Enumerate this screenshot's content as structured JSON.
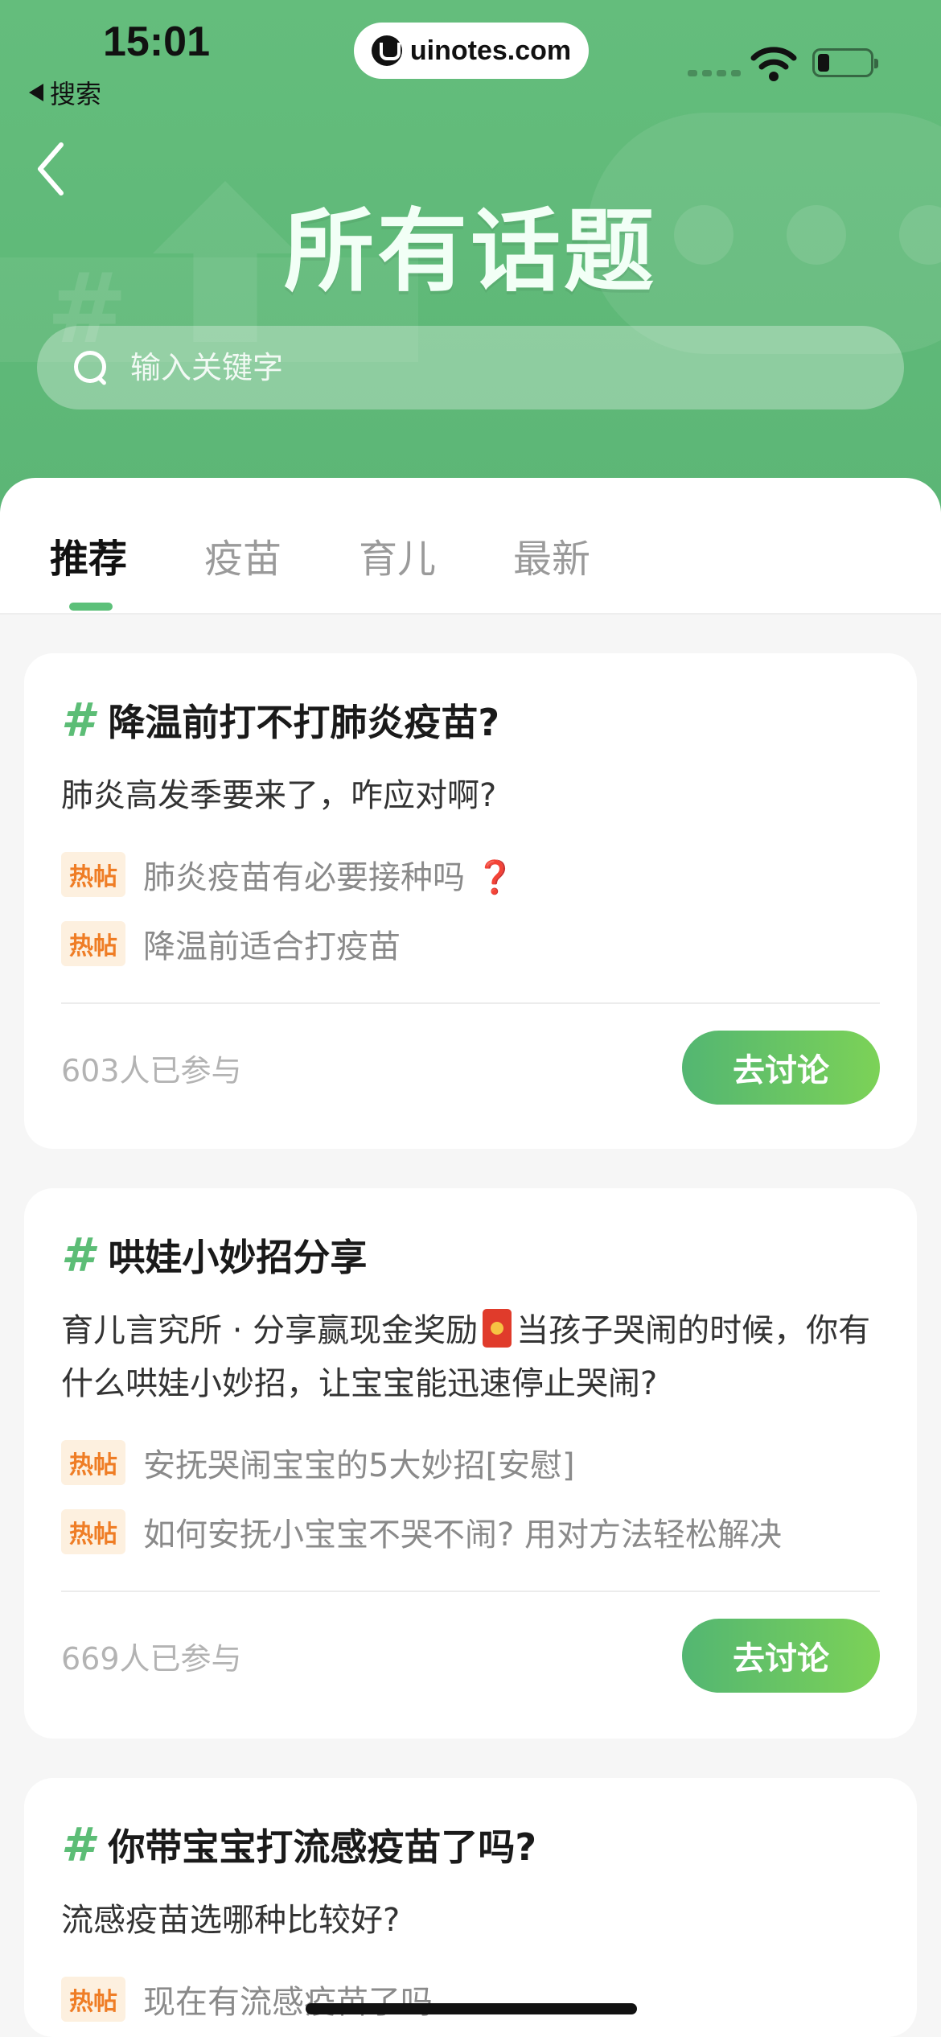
{
  "status_bar": {
    "time": "15:01",
    "back_app": "搜索",
    "url": "uinotes.com"
  },
  "header": {
    "title": "所有话题",
    "search_placeholder": "输入关键字",
    "background_color": "#5cb676"
  },
  "tabs": [
    {
      "label": "推荐",
      "active": true
    },
    {
      "label": "疫苗",
      "active": false
    },
    {
      "label": "育儿",
      "active": false
    },
    {
      "label": "最新",
      "active": false
    }
  ],
  "topics": [
    {
      "hash": "#",
      "title": "降温前打不打肺炎疫苗?",
      "description": "肺炎高发季要来了，咋应对啊?",
      "hot_label": "热帖",
      "hot_posts": [
        {
          "text": "肺炎疫苗有必要接种吗",
          "emoji": "❓"
        },
        {
          "text": "降温前适合打疫苗",
          "emoji": ""
        }
      ],
      "participants": "603人已参与",
      "button": "去讨论"
    },
    {
      "hash": "#",
      "title": "哄娃小妙招分享",
      "description_part1": "育儿言究所 · 分享赢现金奖励",
      "description_part2": "当孩子哭闹的时候，你有什么哄娃小妙招，让宝宝能迅速停止哭闹?",
      "hot_label": "热帖",
      "hot_posts": [
        {
          "text": "安抚哭闹宝宝的5大妙招[安慰]"
        },
        {
          "text": "如何安抚小宝宝不哭不闹? 用对方法轻松解决"
        }
      ],
      "participants": "669人已参与",
      "button": "去讨论"
    },
    {
      "hash": "#",
      "title": "你带宝宝打流感疫苗了吗?",
      "description": "流感疫苗选哪种比较好?",
      "hot_label": "热帖",
      "hot_posts": [
        {
          "text": "现在有流感疫苗了吗"
        }
      ]
    }
  ],
  "colors": {
    "accent_green": "#5cbd76",
    "hot_orange": "#ef7d25",
    "button_gradient_start": "#53b672",
    "button_gradient_end": "#7cd257"
  }
}
